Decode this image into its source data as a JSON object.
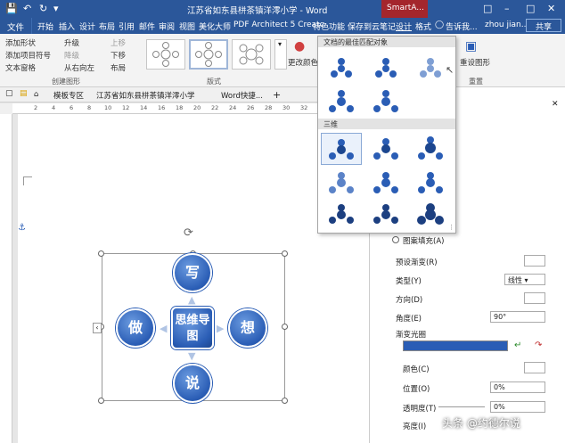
{
  "window": {
    "title": "江苏省如东县栟茶镇洋澪小学 - Word",
    "context_tab": "SmartA...",
    "user": "zhou jian...",
    "share": "共享"
  },
  "tabs": [
    "开始",
    "插入",
    "设计",
    "布局",
    "引用",
    "邮件",
    "审阅",
    "视图",
    "美化大师",
    "PDF Architect 5 Creatc",
    "特色功能",
    "保存到云笔记",
    "设计",
    "格式"
  ],
  "file_tab": "文件",
  "tell_me": "告诉我...",
  "ribbon": {
    "create_graphic": {
      "items": [
        "添加形状",
        "添加项目符号",
        "文本窗格",
        "升级",
        "降级",
        "从右向左",
        "上移",
        "下移",
        "布局"
      ],
      "label": "创建图形"
    },
    "layouts_label": "版式",
    "change_colors": "更改颜色",
    "reset_label": "重置",
    "reset_graphic": "重设图形"
  },
  "doc_tabs": [
    "模板专区",
    "江苏省如东县栟茶镇洋澪小学",
    "Word快捷..."
  ],
  "ruler_numbers": [
    "2",
    "4",
    "6",
    "8",
    "10",
    "12",
    "14",
    "16",
    "18",
    "20",
    "22",
    "24",
    "26",
    "28",
    "30",
    "32",
    "34"
  ],
  "gallery": {
    "section1": "文档的最佳匹配对象",
    "section2": "三维"
  },
  "smartart": {
    "center": "思维导图",
    "top": "写",
    "left": "做",
    "right": "想",
    "bottom": "说"
  },
  "pane": {
    "pattern_fill": "图案填充(A)",
    "preset_gradient": "预设渐变(R)",
    "type": "类型(Y)",
    "type_value": "线性",
    "direction": "方向(D)",
    "angle": "角度(E)",
    "angle_value": "90°",
    "gradient_stops": "渐变光圈",
    "color": "颜色(C)",
    "position": "位置(O)",
    "position_value": "0%",
    "transparency": "透明度(T)",
    "transparency_value": "0%",
    "brightness": "亮度(I)"
  },
  "watermark": "头条 @约德尔说"
}
